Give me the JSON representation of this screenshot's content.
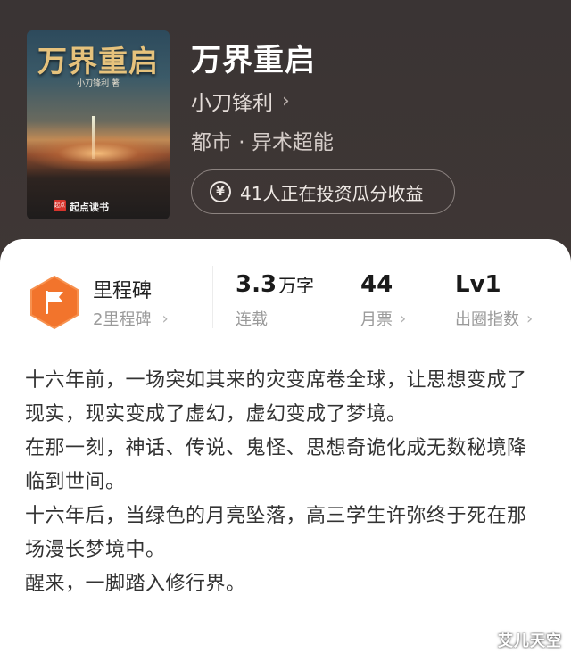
{
  "cover": {
    "title": "万界重启",
    "author_line": "小刀锋利 著",
    "brand": "起点读书",
    "brand_mark": "起点"
  },
  "book": {
    "title": "万界重启",
    "author": "小刀锋利",
    "genre": "都市 · 异术超能"
  },
  "invest": {
    "text": "41人正在投资瓜分收益",
    "icon": "yen-circle-icon"
  },
  "milestone": {
    "label": "里程碑",
    "sub": "2里程碑",
    "icon": "flag-icon",
    "color": "#f2742c"
  },
  "stats": {
    "words": {
      "value": "3.3",
      "unit": "万字",
      "label": "连载"
    },
    "tickets": {
      "value": "44",
      "label": "月票"
    },
    "level": {
      "value": "Lv1",
      "label": "出圈指数"
    }
  },
  "description": [
    "十六年前，一场突如其来的灾变席卷全球，让思想变成了现实，现实变成了虚幻，虚幻变成了梦境。",
    "在那一刻，神话、传说、鬼怪、思想奇诡化成无数秘境降临到世间。",
    "十六年后，当绿色的月亮坠落，高三学生许弥终于死在那场漫长梦境中。",
    "醒来，一脚踏入修行界。"
  ],
  "watermark": "艾儿天空"
}
